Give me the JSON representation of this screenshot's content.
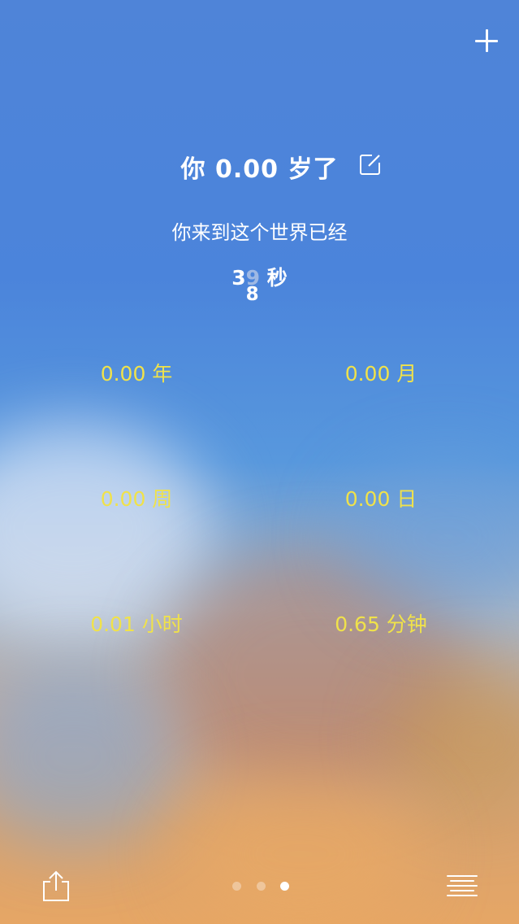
{
  "header": {
    "add_icon": "plus-icon",
    "age_text": "你 0.00 岁了",
    "edit_icon": "edit-icon"
  },
  "summary": {
    "subtitle": "你来到这个世界已经",
    "seconds_first_digit": "3",
    "seconds_rolling_digit": "9",
    "seconds_next_digit": "8",
    "seconds_unit": "秒"
  },
  "stats": {
    "years": "0.00 年",
    "months": "0.00 月",
    "weeks": "0.00 周",
    "days": "0.00 日",
    "hours": "0.01 小时",
    "minutes": "0.65 分钟"
  },
  "footer": {
    "share_icon": "share-icon",
    "page_count": 3,
    "active_page": 3,
    "menu_icon": "menu-icon"
  },
  "colors": {
    "stat_text": "#f0e24a",
    "primary_text": "#ffffff"
  }
}
